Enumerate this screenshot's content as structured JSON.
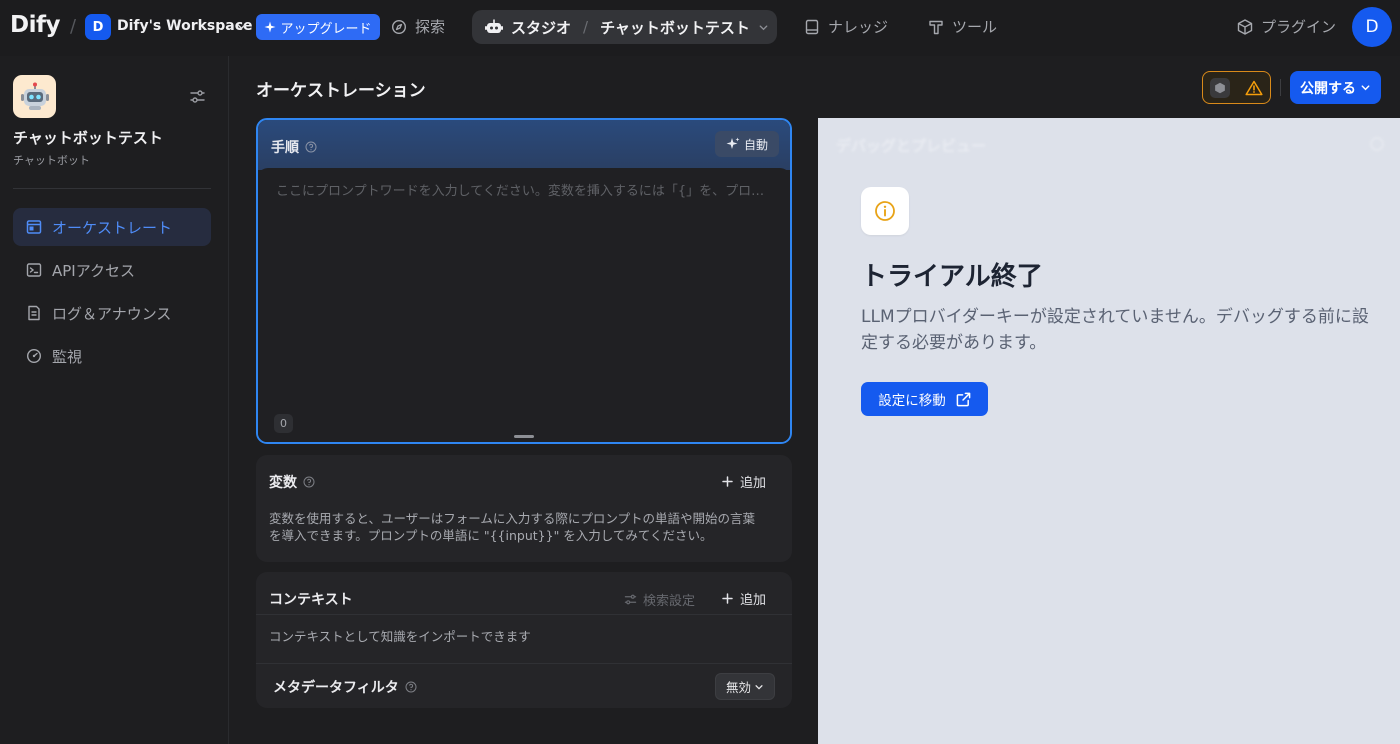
{
  "topbar": {
    "logo": "Dify",
    "workspace_initial": "D",
    "workspace_name": "Dify's Workspace",
    "upgrade_label": "アップグレード",
    "explore_label": "探索",
    "studio_label": "スタジオ",
    "app_label": "チャットボットテスト",
    "knowledge_label": "ナレッジ",
    "tools_label": "ツール",
    "plugins_label": "プラグイン",
    "user_initial": "D"
  },
  "sidebar": {
    "app_name": "チャットボットテスト",
    "app_type": "チャットボット",
    "items": [
      {
        "label": "オーケストレート"
      },
      {
        "label": "APIアクセス"
      },
      {
        "label": "ログ＆アナウンス"
      },
      {
        "label": "監視"
      }
    ]
  },
  "main": {
    "title": "オーケストレーション",
    "publish_label": "公開する",
    "prompt": {
      "title": "手順",
      "auto_label": "自動",
      "placeholder": "ここにプロンプトワードを入力してください。変数を挿入するには「{」を、プロンプトコンテンツブロックを挿入するには「/」を入力します。",
      "char_count": "0"
    },
    "variables": {
      "title": "変数",
      "add_label": "追加",
      "desc_line1": "変数を使用すると、ユーザーはフォームに入力する際にプロンプトの単語や開始の言葉",
      "desc_line2": "を導入できます。プロンプトの単語に \"{{input}}\" を入力してみてください。"
    },
    "context": {
      "title": "コンテキスト",
      "retrieval_label": "検索設定",
      "add_label": "追加",
      "desc": "コンテキストとして知識をインポートできます",
      "metadata_filter_label": "メタデータフィルタ",
      "metadata_filter_value": "無効"
    }
  },
  "preview": {
    "title": "デバッグとプレビュー",
    "trial_title": "トライアル終了",
    "trial_desc": "LLMプロバイダーキーが設定されていません。デバッグする前に設定する必要があります。",
    "goto_label": "設定に移動"
  },
  "colors": {
    "accent": "#155aef",
    "warning": "#d98a1a",
    "active_nav": "#4f8cf7"
  },
  "icons": [
    "explore-icon",
    "robot-icon",
    "knowledge-icon",
    "tools-icon",
    "plugin-icon",
    "sparkle-icon",
    "help-icon",
    "plus-icon",
    "warning-icon",
    "cube-icon",
    "info-icon",
    "external-link-icon"
  ]
}
